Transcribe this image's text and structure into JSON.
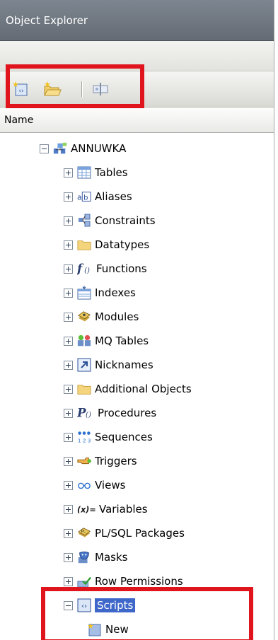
{
  "panel": {
    "title": "Object Explorer"
  },
  "toolbar": {
    "buttons": [
      {
        "name": "new-script-icon"
      },
      {
        "name": "open-folder-icon"
      },
      {
        "name": "properties-icon"
      }
    ]
  },
  "column_header": {
    "label": "Name"
  },
  "tree": {
    "root": {
      "label": "ANNUWKA",
      "icon": "database-icon"
    },
    "children": [
      {
        "label": "Tables",
        "icon": "table-icon"
      },
      {
        "label": "Aliases",
        "icon": "alias-icon"
      },
      {
        "label": "Constraints",
        "icon": "constraint-icon"
      },
      {
        "label": "Datatypes",
        "icon": "folder-icon"
      },
      {
        "label": "Functions",
        "icon": "function-icon"
      },
      {
        "label": "Indexes",
        "icon": "index-icon"
      },
      {
        "label": "Modules",
        "icon": "module-icon"
      },
      {
        "label": "MQ Tables",
        "icon": "mq-table-icon"
      },
      {
        "label": "Nicknames",
        "icon": "nickname-icon"
      },
      {
        "label": "Additional Objects",
        "icon": "folder-icon"
      },
      {
        "label": "Procedures",
        "icon": "procedure-icon"
      },
      {
        "label": "Sequences",
        "icon": "sequence-icon"
      },
      {
        "label": "Triggers",
        "icon": "trigger-icon"
      },
      {
        "label": "Views",
        "icon": "view-icon"
      },
      {
        "label": "Variables",
        "icon": "variable-icon"
      },
      {
        "label": "PL/SQL Packages",
        "icon": "package-icon"
      },
      {
        "label": "Masks",
        "icon": "mask-icon"
      },
      {
        "label": "Row Permissions",
        "icon": "row-permission-icon"
      },
      {
        "label": "Scripts",
        "icon": "script-icon"
      }
    ],
    "script_child": {
      "label": "New",
      "icon": "new-script-icon"
    }
  },
  "colors": {
    "highlight": "#e0141c",
    "selection": "#3e67c9"
  }
}
